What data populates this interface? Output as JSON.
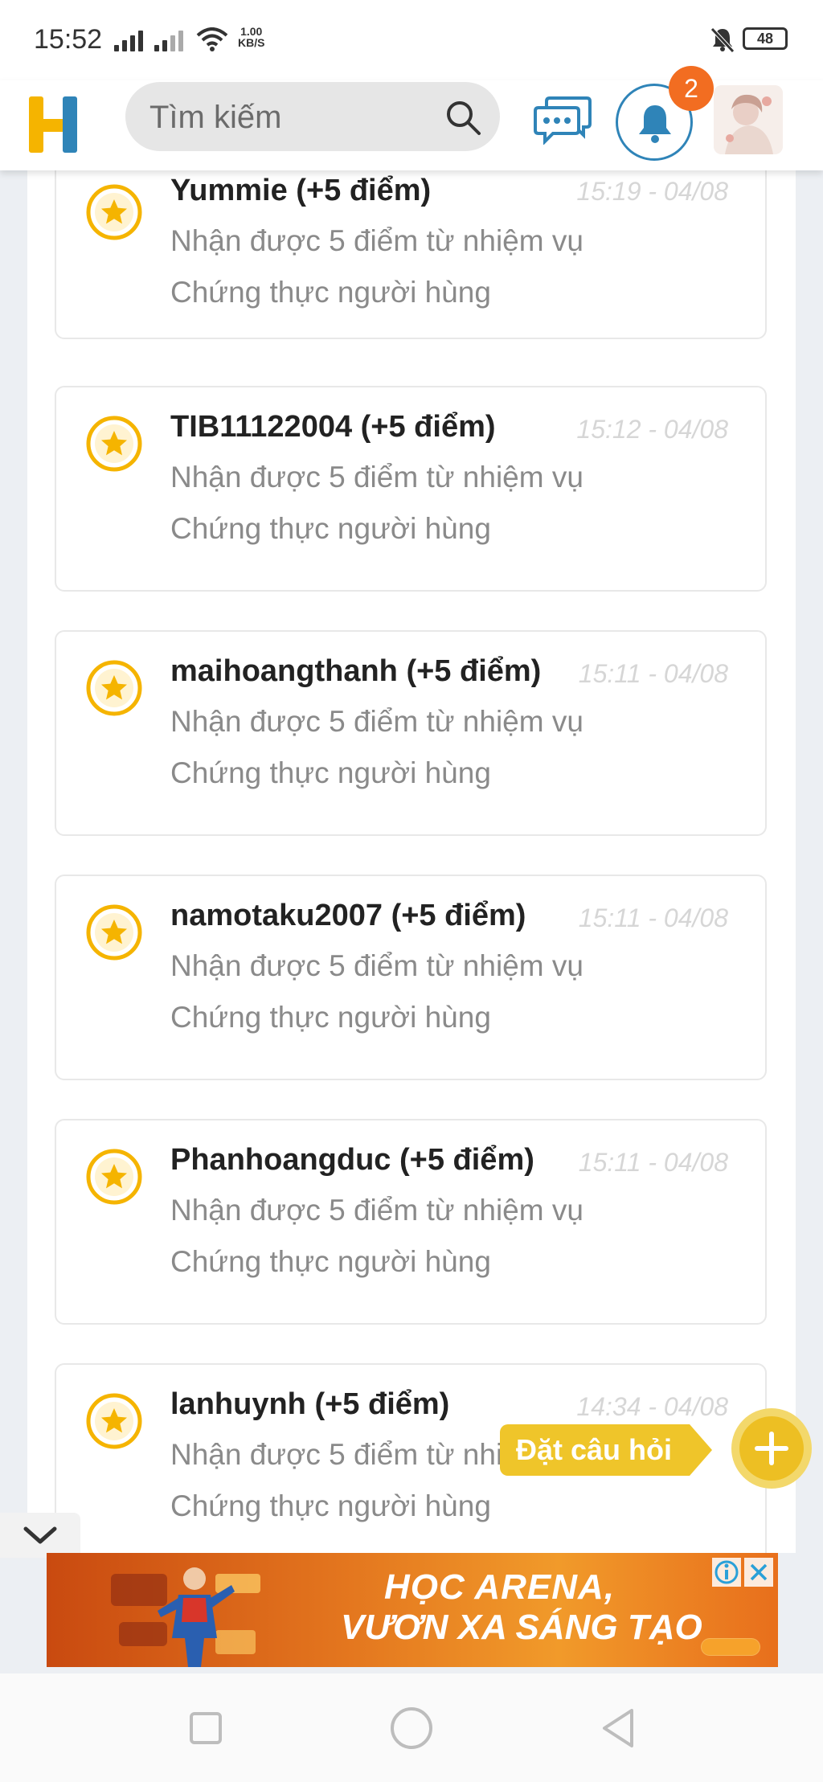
{
  "status_bar": {
    "time": "15:52",
    "net_speed_value": "1.00",
    "net_speed_unit": "KB/S",
    "battery": "48"
  },
  "header": {
    "search_placeholder": "Tìm kiếm",
    "notification_count": "2"
  },
  "notifications": [
    {
      "title": "Yummie (+5 điểm)",
      "time": "15:19 - 04/08",
      "desc_line1": "Nhận được 5 điểm từ nhiệm vụ",
      "desc_line2": "Chứng thực người hùng"
    },
    {
      "title": "TIB11122004 (+5 điểm)",
      "time": "15:12 - 04/08",
      "desc_line1": "Nhận được 5 điểm từ nhiệm vụ",
      "desc_line2": "Chứng thực người hùng"
    },
    {
      "title": "maihoangthanh (+5 điểm)",
      "time": "15:11 - 04/08",
      "desc_line1": "Nhận được 5 điểm từ nhiệm vụ",
      "desc_line2": "Chứng thực người hùng"
    },
    {
      "title": "namotaku2007 (+5 điểm)",
      "time": "15:11 - 04/08",
      "desc_line1": "Nhận được 5 điểm từ nhiệm vụ",
      "desc_line2": "Chứng thực người hùng"
    },
    {
      "title": "Phanhoangduc (+5 điểm)",
      "time": "15:11 - 04/08",
      "desc_line1": "Nhận được 5 điểm từ nhiệm vụ",
      "desc_line2": "Chứng thực người hùng"
    },
    {
      "title": "lanhuynh (+5 điểm)",
      "time": "14:34 - 04/08",
      "desc_line1": "Nhận được 5 điểm từ nhiệm vụ",
      "desc_line2": "Chứng thực người hùng"
    }
  ],
  "fab": {
    "label": "Đặt câu hỏi"
  },
  "ad": {
    "line1": "HỌC ARENA,",
    "line2": "VƯƠN XA SÁNG TẠO"
  },
  "colors": {
    "brand_yellow": "#efc52a",
    "brand_blue": "#2f84b8",
    "badge_orange": "#f26d21",
    "star_gold": "#f5b400"
  }
}
